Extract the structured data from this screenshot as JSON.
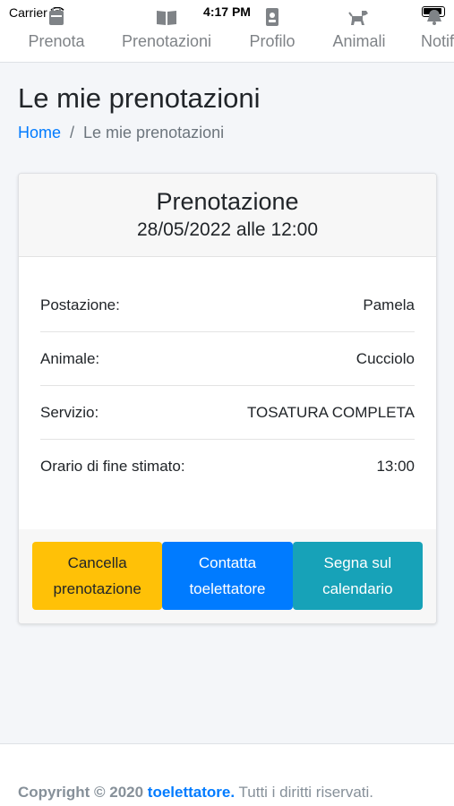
{
  "status": {
    "carrier": "Carrier",
    "time": "4:17 PM"
  },
  "nav": {
    "items": [
      {
        "label": "Prenota",
        "icon": "calendar-icon"
      },
      {
        "label": "Prenotazioni",
        "icon": "book-icon"
      },
      {
        "label": "Profilo",
        "icon": "id-card-icon"
      },
      {
        "label": "Animali",
        "icon": "dog-icon"
      },
      {
        "label": "Notifiche",
        "icon": "bell-icon"
      }
    ]
  },
  "header": {
    "title": "Le mie prenotazioni",
    "breadcrumb": {
      "home": "Home",
      "separator": "/",
      "current": "Le mie prenotazioni"
    }
  },
  "booking": {
    "title": "Prenotazione",
    "datetime": "28/05/2022 alle 12:00",
    "rows": [
      {
        "label": "Postazione:",
        "value": "Pamela"
      },
      {
        "label": "Animale:",
        "value": "Cucciolo"
      },
      {
        "label": "Servizio:",
        "value": "TOSATURA COMPLETA"
      },
      {
        "label": "Orario di fine stimato:",
        "value": "13:00"
      }
    ],
    "buttons": {
      "cancel": "Cancella prenotazione",
      "contact": "Contatta toelettatore",
      "calendar": "Segna sul calendario"
    }
  },
  "footer": {
    "copyright": "Copyright © 2020",
    "brand": "toelettatore.",
    "rights": "Tutti i diritti riservati."
  },
  "colors": {
    "primary": "#007bff",
    "warning": "#ffc107",
    "info": "#17a2b8"
  }
}
